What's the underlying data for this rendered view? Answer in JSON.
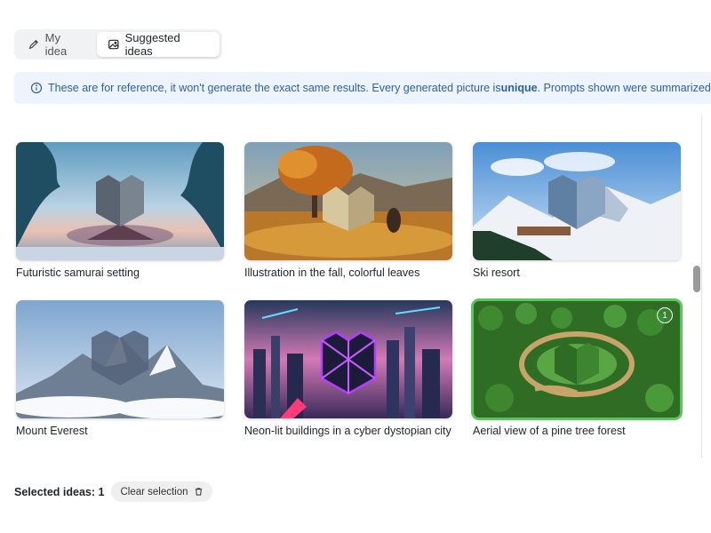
{
  "tabs": [
    {
      "label": "My idea",
      "icon": "pencil-icon",
      "active": false
    },
    {
      "label": "Suggested ideas",
      "icon": "image-icon",
      "active": true
    }
  ],
  "notice": {
    "icon": "info-icon",
    "text_before": "These are for reference, it won't generate the exact same results. Every generated picture is ",
    "emphasis": "unique",
    "text_after": ". Prompts shown were summarized."
  },
  "cards": [
    {
      "caption": "Futuristic samurai setting",
      "selected": false
    },
    {
      "caption": "Illustration in the fall, colorful leaves",
      "selected": false
    },
    {
      "caption": "Ski resort",
      "selected": false
    },
    {
      "caption": "Mount Everest",
      "selected": false
    },
    {
      "caption": "Neon-lit buildings in a cyber dystopian city",
      "selected": false
    },
    {
      "caption": "Aerial view of a pine tree forest",
      "selected": true,
      "badge": "1"
    }
  ],
  "footer": {
    "selected_label": "Selected ideas: 1",
    "clear_label": "Clear selection"
  },
  "colors": {
    "accent_blue": "#2d5fa8",
    "notice_bg": "#eef4fd",
    "selected_green": "#5cc45c"
  }
}
